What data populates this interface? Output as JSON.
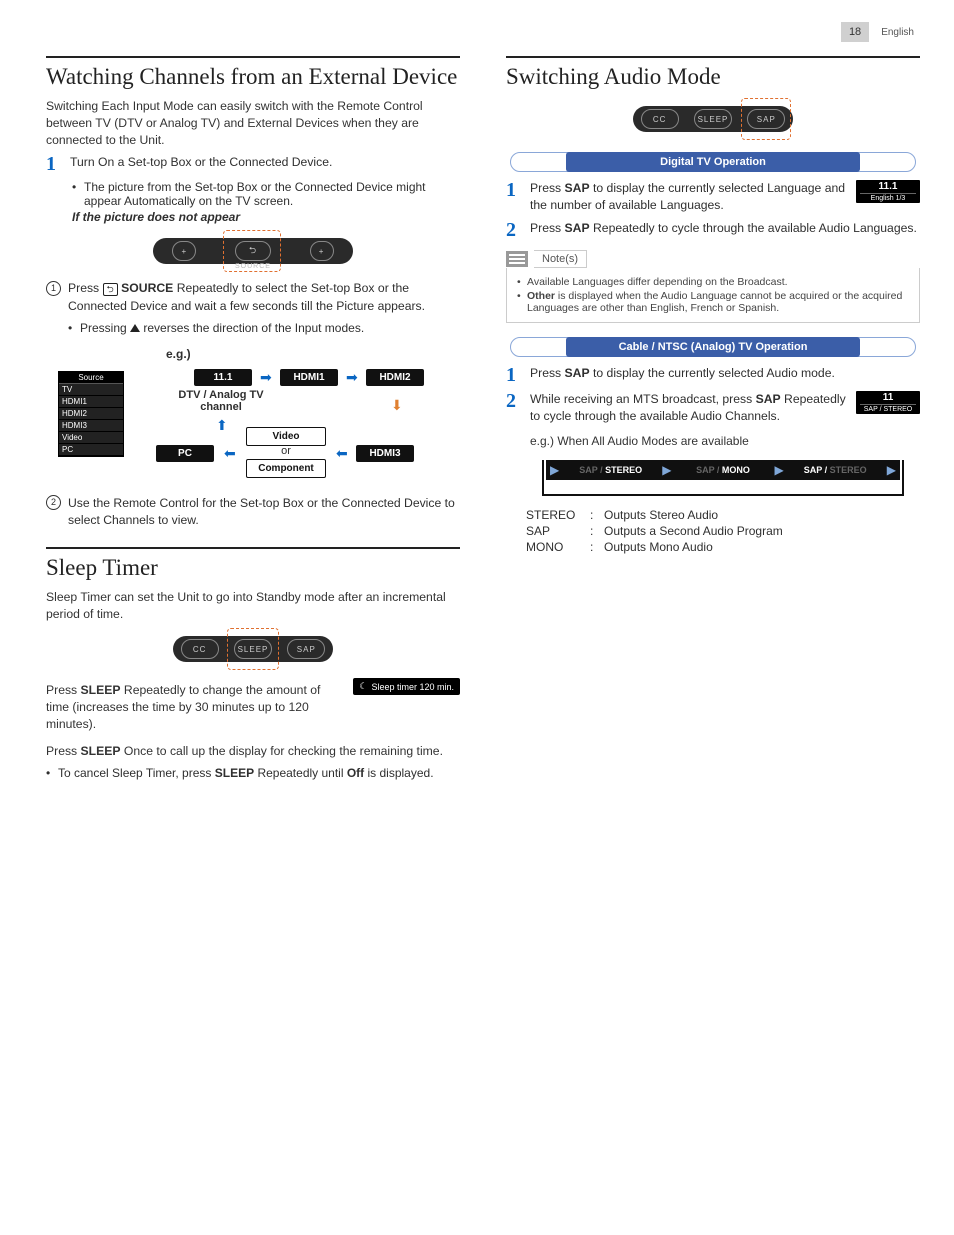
{
  "header": {
    "page": "18",
    "lang": "English"
  },
  "left": {
    "h1": "Watching Channels from an External Device",
    "intro": "Switching Each Input Mode can easily switch with the Remote Control between TV (DTV or Analog TV) and External Devices when they are connected to the Unit.",
    "step1": "Turn On a Set-top Box or the Connected Device.",
    "step1a": "The picture from the Set-top Box or the Connected Device might appear Automatically on the TV screen.",
    "step1b": "If the picture does not appear",
    "remote_source": {
      "label": "SOURCE",
      "plus": "+"
    },
    "c1a": "Press",
    "c1b": "SOURCE",
    "c1c": " Repeatedly to select the Set-top Box or the Connected Device and wait a few seconds till the Picture appears.",
    "c1bul": "Pressing ▲ reverses the direction of the Input modes.",
    "eg": "e.g.)",
    "flow": {
      "menu_header": "Source",
      "menu": [
        "TV",
        "HDMI1",
        "HDMI2",
        "HDMI3",
        "Video",
        "PC"
      ],
      "n111": "11.1",
      "hdmi1": "HDMI1",
      "hdmi2": "HDMI2",
      "hdmi3": "HDMI3",
      "pc": "PC",
      "dtv": "DTV / Analog TV channel",
      "video_or": "Video or Component"
    },
    "c2": "Use the Remote Control for the Set-top Box or the Connected Device to select Channels to view.",
    "h2": "Sleep Timer",
    "sleep_intro": "Sleep Timer can set the Unit to go into Standby mode after an incremental period of time.",
    "remote_sleep": {
      "cc": "CC",
      "sleep": "SLEEP",
      "sap": "SAP"
    },
    "sleep_p1a": "Press ",
    "sleep_p1b": "SLEEP",
    "sleep_p1c": " Repeatedly to change the amount of time (increases the time by 30 minutes up to 120 minutes).",
    "osd": "Sleep timer   120 min.",
    "sleep_p2a": "Press ",
    "sleep_p2b": "SLEEP",
    "sleep_p2c": " Once to call up the display for checking the remaining time.",
    "sleep_p3a": "To cancel Sleep Timer, press ",
    "sleep_p3b": "SLEEP",
    "sleep_p3c": " Repeatedly until ",
    "sleep_p3d": "Off",
    "sleep_p3e": " is displayed."
  },
  "right": {
    "h1": "Switching Audio Mode",
    "remote": {
      "cc": "CC",
      "sleep": "SLEEP",
      "sap": "SAP"
    },
    "rib1": "Digital TV Operation",
    "d1a": "Press ",
    "d1b": "SAP",
    "d1c": " to display the currently selected Language and the number of available Languages.",
    "disp1": {
      "top": "11.1",
      "sub": "English 1/3"
    },
    "d2a": "Press ",
    "d2b": "SAP",
    "d2c": " Repeatedly to cycle through the available Audio Languages.",
    "notes_label": "Note(s)",
    "note1": "Available Languages differ depending on the Broadcast.",
    "note2a": "Other",
    "note2b": " is displayed when the Audio Language cannot be acquired or the acquired Languages are other than English, French or Spanish.",
    "rib2": "Cable / NTSC (Analog) TV Operation",
    "a1a": "Press ",
    "a1b": "SAP",
    "a1c": " to display the currently selected Audio mode.",
    "a2a": "While receiving an MTS broadcast, press ",
    "a2b": "SAP",
    "a2c": " Repeatedly to cycle through the available Audio Channels.",
    "disp2": {
      "top": "11",
      "sub": "SAP / STEREO"
    },
    "eg": "e.g.) When All Audio Modes are available",
    "cycle": {
      "s1d": "SAP /",
      "s1": "STEREO",
      "s2d": "SAP /",
      "s2": "MONO",
      "s3": "SAP /",
      "s3d": "STEREO"
    },
    "defs": [
      {
        "k": "STEREO",
        "v": "Outputs Stereo Audio"
      },
      {
        "k": "SAP",
        "v": "Outputs a Second Audio Program"
      },
      {
        "k": "MONO",
        "v": "Outputs Mono Audio"
      }
    ]
  }
}
